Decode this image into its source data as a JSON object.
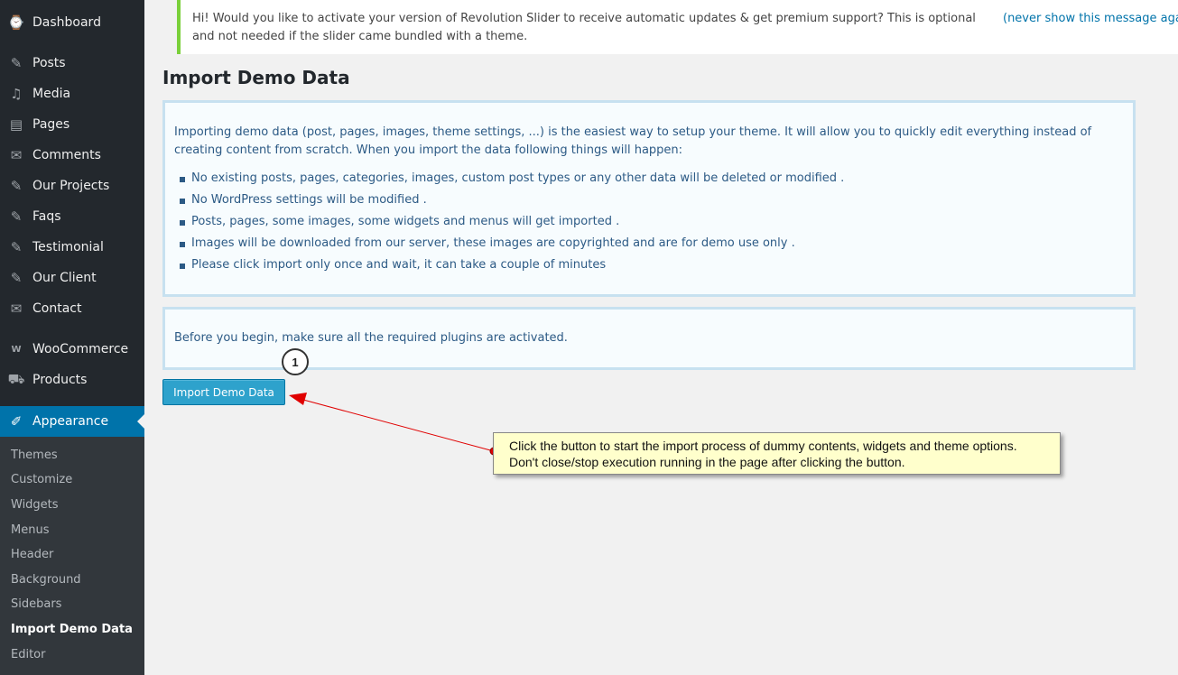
{
  "sidebar": {
    "items": [
      {
        "label": "Dashboard",
        "icon": "dashboard-icon",
        "glyph": "⌚"
      },
      {
        "label": "Posts",
        "icon": "pin-icon",
        "glyph": "✎"
      },
      {
        "label": "Media",
        "icon": "media-icon",
        "glyph": "♫"
      },
      {
        "label": "Pages",
        "icon": "pages-icon",
        "glyph": "▤"
      },
      {
        "label": "Comments",
        "icon": "comment-icon",
        "glyph": "✉"
      },
      {
        "label": "Our Projects",
        "icon": "pin-icon",
        "glyph": "✎"
      },
      {
        "label": "Faqs",
        "icon": "pin-icon",
        "glyph": "✎"
      },
      {
        "label": "Testimonial",
        "icon": "pin-icon",
        "glyph": "✎"
      },
      {
        "label": "Our Client",
        "icon": "pin-icon",
        "glyph": "✎"
      },
      {
        "label": "Contact",
        "icon": "mail-icon",
        "glyph": "✉"
      },
      {
        "label": "WooCommerce",
        "icon": "woocommerce-icon",
        "glyph": "W"
      },
      {
        "label": "Products",
        "icon": "cart-icon",
        "glyph": "⛟"
      },
      {
        "label": "Appearance",
        "icon": "paintbrush-icon",
        "glyph": "✐"
      }
    ],
    "submenu": [
      "Themes",
      "Customize",
      "Widgets",
      "Menus",
      "Header",
      "Background",
      "Sidebars",
      "Import Demo Data",
      "Editor"
    ]
  },
  "notice": {
    "message": "Hi! Would you like to activate your version of Revolution Slider to receive automatic updates & get premium support? This is optional and not needed if the slider came bundled with a theme.",
    "dismiss": "(never show this message again)"
  },
  "main": {
    "title": "Import Demo Data",
    "intro": "Importing demo data (post, pages, images, theme settings, ...) is the easiest way to setup your theme. It will allow you to quickly edit everything instead of creating content from scratch. When you import the data following things will happen:",
    "bullets": [
      "No existing posts, pages, categories, images, custom post types or any other data will be deleted or modified .",
      "No WordPress settings will be modified .",
      "Posts, pages, some images, some widgets and menus will get imported .",
      "Images will be downloaded from our server, these images are copyrighted and are for demo use only .",
      "Please click import only once and wait, it can take a couple of minutes"
    ],
    "notice2": "Before you begin, make sure all the required plugins are activated.",
    "button": "Import Demo Data"
  },
  "annotation": {
    "step": "1",
    "callout_line1": "Click the button to start the import process of dummy contents, widgets and theme options.",
    "callout_line2": "Don't close/stop execution running in the page after clicking the button."
  },
  "colors": {
    "accent": "#0073aa",
    "button": "#2ea2cc",
    "arrow": "#e00000",
    "notice_border": "#7ad03a"
  }
}
